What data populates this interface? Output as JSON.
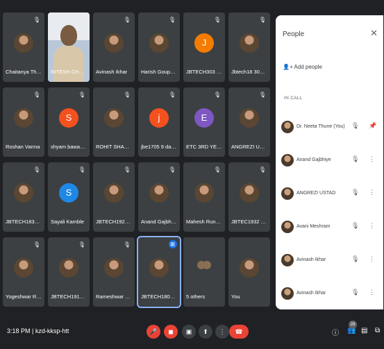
{
  "tiles": [
    {
      "name": "Chaitanya Thiske",
      "type": "photo",
      "muted": true
    },
    {
      "name": "RITESH CHAN...",
      "type": "video",
      "muted": true
    },
    {
      "name": "Avinash Ikhar",
      "type": "photo",
      "muted": true
    },
    {
      "name": "Harish Goupale",
      "type": "photo",
      "muted": true
    },
    {
      "name": "JBTECH303 Su...",
      "type": "letter",
      "initial": "J",
      "color": "#f57c00",
      "muted": true
    },
    {
      "name": "Jbtech18 307 H...",
      "type": "photo",
      "muted": true
    },
    {
      "name": "Roshan Varma",
      "type": "photo",
      "muted": true
    },
    {
      "name": "shyam bawankar",
      "type": "letter",
      "initial": "S",
      "color": "#f4511e",
      "muted": true
    },
    {
      "name": "ROHIT SHAHARE",
      "type": "photo",
      "muted": true
    },
    {
      "name": "jbe1705 9 dami...",
      "type": "letter",
      "initial": "j",
      "color": "#f4511e",
      "muted": true
    },
    {
      "name": "ETC 3RD YEAR",
      "type": "letter",
      "initial": "E",
      "color": "#7e57c2",
      "muted": true
    },
    {
      "name": "ANGREZI USTAD",
      "type": "photo",
      "muted": true
    },
    {
      "name": "JBTECH1830 4 ...",
      "type": "photo",
      "muted": true
    },
    {
      "name": "Sayali Kamble",
      "type": "letter",
      "initial": "S",
      "color": "#1e88e5",
      "muted": true
    },
    {
      "name": "JBTECH1921 S ...",
      "type": "photo",
      "muted": true
    },
    {
      "name": "Anand Gajbhiye",
      "type": "photo",
      "muted": true
    },
    {
      "name": "Mahesh Runna...",
      "type": "photo",
      "muted": true
    },
    {
      "name": "JBTEC1932 4M...",
      "type": "photo",
      "muted": true
    },
    {
      "name": "Yogeshwar Rak...",
      "type": "photo",
      "muted": true
    },
    {
      "name": "JBTECH1917 Sa...",
      "type": "photo",
      "muted": true
    },
    {
      "name": "Rameshwar Sin...",
      "type": "photo",
      "muted": true
    },
    {
      "name": "JBTECH1803 9 ...",
      "type": "photo",
      "muted": false,
      "speaking": true
    },
    {
      "name": "5 others",
      "type": "others",
      "muted": false
    },
    {
      "name": "You",
      "type": "photo",
      "muted": false
    }
  ],
  "panel": {
    "title": "People",
    "add_people": "Add people",
    "in_call": "IN CALL",
    "close_icon": "close-icon",
    "participants": [
      {
        "name": "Dr. Neeta Thune (You)",
        "more": "pin"
      },
      {
        "name": "Anand Gajbhiye",
        "more": "more"
      },
      {
        "name": "ANGREZI USTAD",
        "more": "more"
      },
      {
        "name": "Avani Meshram",
        "more": "more"
      },
      {
        "name": "Avinash Ikhar",
        "more": "more"
      },
      {
        "name": "Avinash Ikhar",
        "more": "more"
      }
    ]
  },
  "bottom": {
    "time": "3:18 PM",
    "meeting_code": "kzd-kksp-htt",
    "people_count": "28"
  },
  "colors": {
    "background": "#202124",
    "tile": "#3c4043",
    "danger": "#ea4335",
    "accent": "#1a73e8"
  }
}
